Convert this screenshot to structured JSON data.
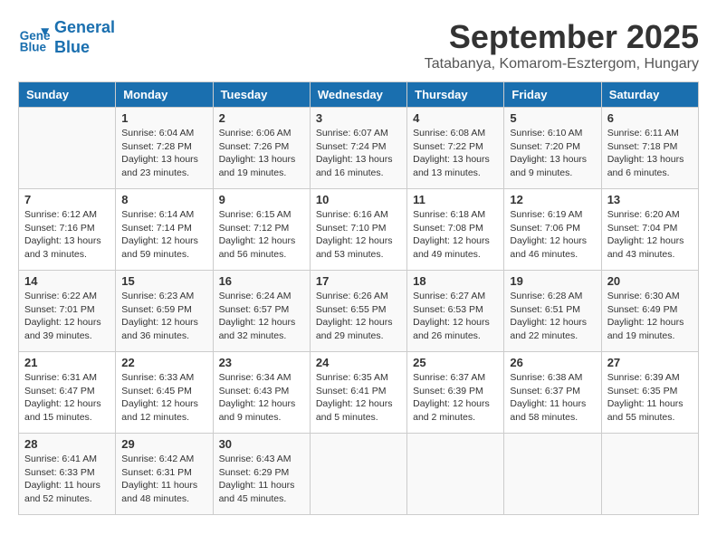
{
  "header": {
    "logo_line1": "General",
    "logo_line2": "Blue",
    "month_title": "September 2025",
    "location": "Tatabanya, Komarom-Esztergom, Hungary"
  },
  "days_of_week": [
    "Sunday",
    "Monday",
    "Tuesday",
    "Wednesday",
    "Thursday",
    "Friday",
    "Saturday"
  ],
  "weeks": [
    [
      {
        "day": "",
        "info": ""
      },
      {
        "day": "1",
        "info": "Sunrise: 6:04 AM\nSunset: 7:28 PM\nDaylight: 13 hours\nand 23 minutes."
      },
      {
        "day": "2",
        "info": "Sunrise: 6:06 AM\nSunset: 7:26 PM\nDaylight: 13 hours\nand 19 minutes."
      },
      {
        "day": "3",
        "info": "Sunrise: 6:07 AM\nSunset: 7:24 PM\nDaylight: 13 hours\nand 16 minutes."
      },
      {
        "day": "4",
        "info": "Sunrise: 6:08 AM\nSunset: 7:22 PM\nDaylight: 13 hours\nand 13 minutes."
      },
      {
        "day": "5",
        "info": "Sunrise: 6:10 AM\nSunset: 7:20 PM\nDaylight: 13 hours\nand 9 minutes."
      },
      {
        "day": "6",
        "info": "Sunrise: 6:11 AM\nSunset: 7:18 PM\nDaylight: 13 hours\nand 6 minutes."
      }
    ],
    [
      {
        "day": "7",
        "info": "Sunrise: 6:12 AM\nSunset: 7:16 PM\nDaylight: 13 hours\nand 3 minutes."
      },
      {
        "day": "8",
        "info": "Sunrise: 6:14 AM\nSunset: 7:14 PM\nDaylight: 12 hours\nand 59 minutes."
      },
      {
        "day": "9",
        "info": "Sunrise: 6:15 AM\nSunset: 7:12 PM\nDaylight: 12 hours\nand 56 minutes."
      },
      {
        "day": "10",
        "info": "Sunrise: 6:16 AM\nSunset: 7:10 PM\nDaylight: 12 hours\nand 53 minutes."
      },
      {
        "day": "11",
        "info": "Sunrise: 6:18 AM\nSunset: 7:08 PM\nDaylight: 12 hours\nand 49 minutes."
      },
      {
        "day": "12",
        "info": "Sunrise: 6:19 AM\nSunset: 7:06 PM\nDaylight: 12 hours\nand 46 minutes."
      },
      {
        "day": "13",
        "info": "Sunrise: 6:20 AM\nSunset: 7:04 PM\nDaylight: 12 hours\nand 43 minutes."
      }
    ],
    [
      {
        "day": "14",
        "info": "Sunrise: 6:22 AM\nSunset: 7:01 PM\nDaylight: 12 hours\nand 39 minutes."
      },
      {
        "day": "15",
        "info": "Sunrise: 6:23 AM\nSunset: 6:59 PM\nDaylight: 12 hours\nand 36 minutes."
      },
      {
        "day": "16",
        "info": "Sunrise: 6:24 AM\nSunset: 6:57 PM\nDaylight: 12 hours\nand 32 minutes."
      },
      {
        "day": "17",
        "info": "Sunrise: 6:26 AM\nSunset: 6:55 PM\nDaylight: 12 hours\nand 29 minutes."
      },
      {
        "day": "18",
        "info": "Sunrise: 6:27 AM\nSunset: 6:53 PM\nDaylight: 12 hours\nand 26 minutes."
      },
      {
        "day": "19",
        "info": "Sunrise: 6:28 AM\nSunset: 6:51 PM\nDaylight: 12 hours\nand 22 minutes."
      },
      {
        "day": "20",
        "info": "Sunrise: 6:30 AM\nSunset: 6:49 PM\nDaylight: 12 hours\nand 19 minutes."
      }
    ],
    [
      {
        "day": "21",
        "info": "Sunrise: 6:31 AM\nSunset: 6:47 PM\nDaylight: 12 hours\nand 15 minutes."
      },
      {
        "day": "22",
        "info": "Sunrise: 6:33 AM\nSunset: 6:45 PM\nDaylight: 12 hours\nand 12 minutes."
      },
      {
        "day": "23",
        "info": "Sunrise: 6:34 AM\nSunset: 6:43 PM\nDaylight: 12 hours\nand 9 minutes."
      },
      {
        "day": "24",
        "info": "Sunrise: 6:35 AM\nSunset: 6:41 PM\nDaylight: 12 hours\nand 5 minutes."
      },
      {
        "day": "25",
        "info": "Sunrise: 6:37 AM\nSunset: 6:39 PM\nDaylight: 12 hours\nand 2 minutes."
      },
      {
        "day": "26",
        "info": "Sunrise: 6:38 AM\nSunset: 6:37 PM\nDaylight: 11 hours\nand 58 minutes."
      },
      {
        "day": "27",
        "info": "Sunrise: 6:39 AM\nSunset: 6:35 PM\nDaylight: 11 hours\nand 55 minutes."
      }
    ],
    [
      {
        "day": "28",
        "info": "Sunrise: 6:41 AM\nSunset: 6:33 PM\nDaylight: 11 hours\nand 52 minutes."
      },
      {
        "day": "29",
        "info": "Sunrise: 6:42 AM\nSunset: 6:31 PM\nDaylight: 11 hours\nand 48 minutes."
      },
      {
        "day": "30",
        "info": "Sunrise: 6:43 AM\nSunset: 6:29 PM\nDaylight: 11 hours\nand 45 minutes."
      },
      {
        "day": "",
        "info": ""
      },
      {
        "day": "",
        "info": ""
      },
      {
        "day": "",
        "info": ""
      },
      {
        "day": "",
        "info": ""
      }
    ]
  ]
}
